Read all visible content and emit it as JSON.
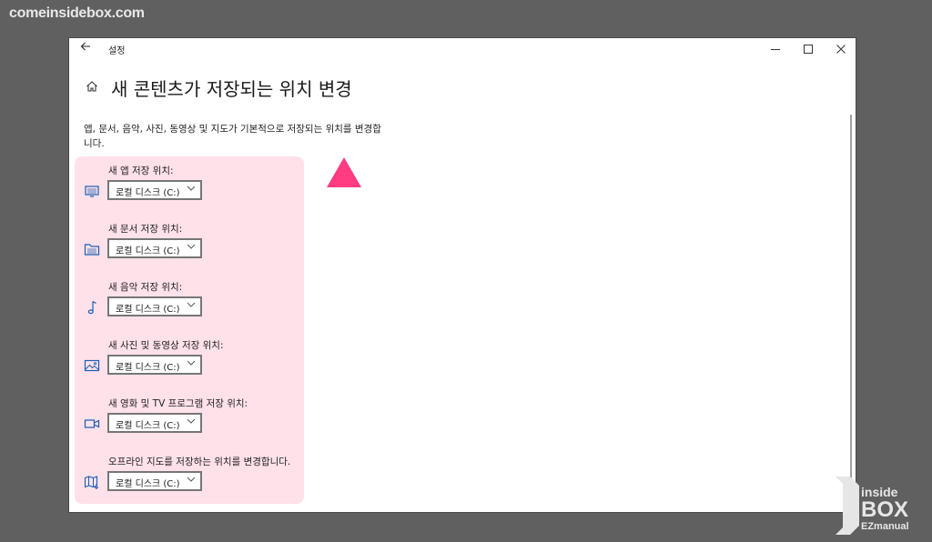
{
  "watermark_top": "comeinsidebox.com",
  "window": {
    "app_title": "설정",
    "page_title": "새 콘텐츠가 저장되는 위치 변경",
    "description": "앱, 문서, 음악, 사진, 동영상 및 지도가 기본적으로 저장되는 위치를 변경합니다."
  },
  "items": [
    {
      "label": "새 앱 저장 위치:",
      "value": "로컬 디스크 (C:)",
      "icon": "monitor-icon"
    },
    {
      "label": "새 문서 저장 위치:",
      "value": "로컬 디스크 (C:)",
      "icon": "folder-icon"
    },
    {
      "label": "새 음악 저장 위치:",
      "value": "로컬 디스크 (C:)",
      "icon": "music-note-icon"
    },
    {
      "label": "새 사진 및 동영상 저장 위치:",
      "value": "로컬 디스크 (C:)",
      "icon": "picture-icon"
    },
    {
      "label": "새 영화 및 TV 프로그램 저장 위치:",
      "value": "로컬 디스크 (C:)",
      "icon": "video-camera-icon"
    },
    {
      "label": "오프라인 지도를 저장하는 위치를 변경합니다.",
      "value": "로컬 디스크 (C:)",
      "icon": "map-icon"
    }
  ],
  "logo": {
    "line1": "inside",
    "line2": "BOX",
    "line3": "EZmanual"
  },
  "colors": {
    "highlight": "#ffe1ea",
    "marker": "#ff3b81",
    "icon": "#1a5fb4"
  }
}
